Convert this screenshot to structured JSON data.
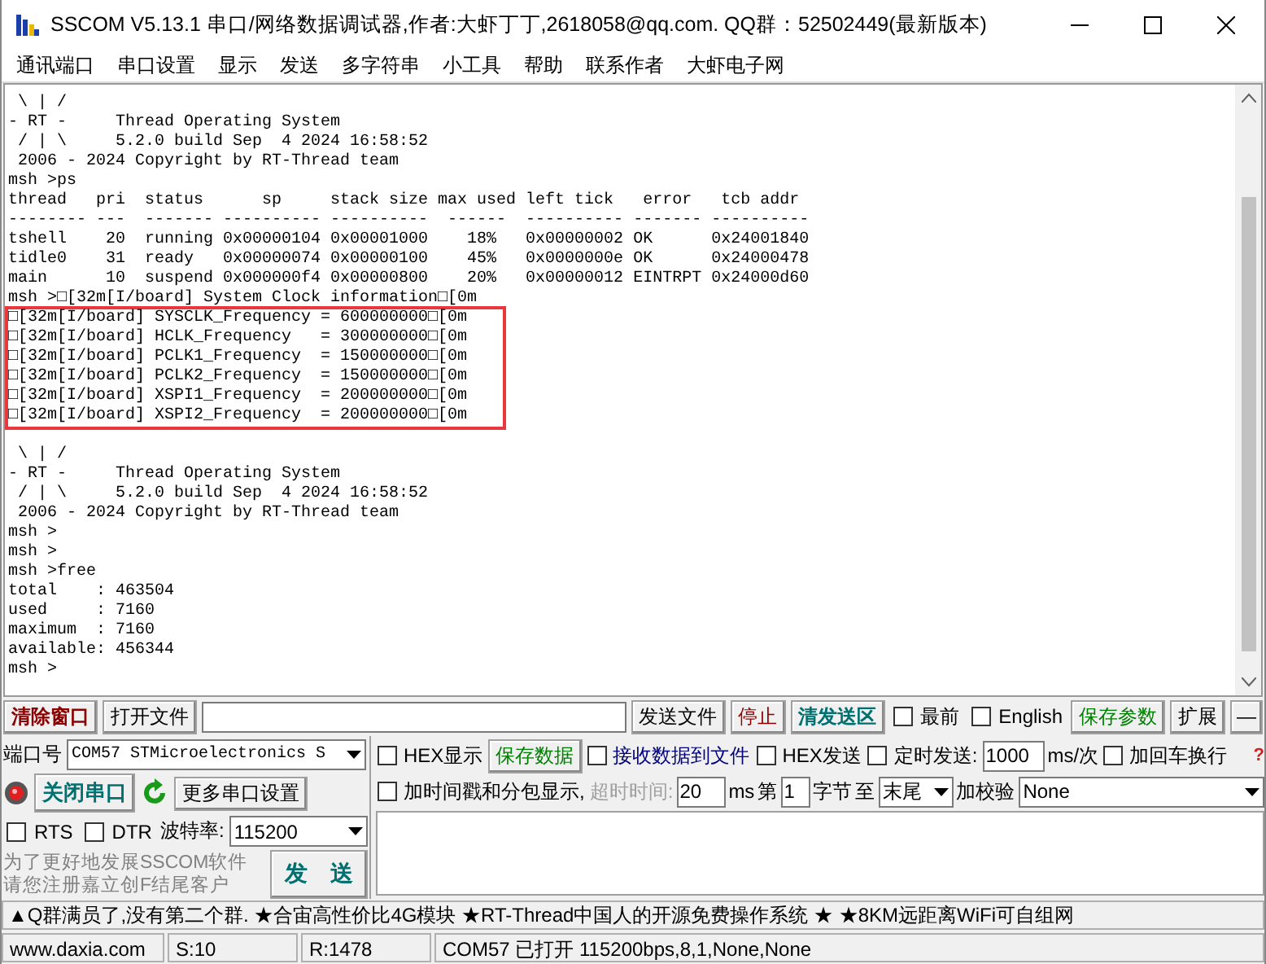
{
  "window": {
    "title": "SSCOM V5.13.1 串口/网络数据调试器,作者:大虾丁丁,2618058@qq.com. QQ群：52502449(最新版本)"
  },
  "menu": [
    "通讯端口",
    "串口设置",
    "显示",
    "发送",
    "多字符串",
    "小工具",
    "帮助",
    "联系作者",
    "大虾电子网"
  ],
  "terminal": {
    "blocks": [
      {
        "kind": "plain",
        "lines": [
          " \\ | /",
          "- RT -     Thread Operating System",
          " / | \\     5.2.0 build Sep  4 2024 16:58:52",
          " 2006 - 2024 Copyright by RT-Thread team",
          "msh >ps",
          "thread   pri  status      sp     stack size max used left tick   error   tcb addr",
          "-------- ---  ------- ---------- ----------  ------  ---------- ------- ----------",
          "tshell    20  running 0x00000104 0x00001000    18%   0x00000002 OK      0x24001840",
          "tidle0    31  ready   0x00000074 0x00000100    45%   0x0000000e OK      0x24000478",
          "main      10  suspend 0x000000f4 0x00000800    20%   0x00000012 EINTRPT 0x24000d60",
          "msh >□[32m[I/board] System Clock information□[0m"
        ]
      },
      {
        "kind": "highlighted",
        "lines": [
          "□[32m[I/board] SYSCLK_Frequency = 600000000□[0m",
          "□[32m[I/board] HCLK_Frequency   = 300000000□[0m",
          "□[32m[I/board] PCLK1_Frequency  = 150000000□[0m",
          "□[32m[I/board] PCLK2_Frequency  = 150000000□[0m",
          "□[32m[I/board] XSPI1_Frequency  = 200000000□[0m",
          "□[32m[I/board] XSPI2_Frequency  = 200000000□[0m"
        ]
      },
      {
        "kind": "plain",
        "lines": [
          " \\ | /",
          "- RT -     Thread Operating System",
          " / | \\     5.2.0 build Sep  4 2024 16:58:52",
          " 2006 - 2024 Copyright by RT-Thread team",
          "msh >",
          "msh >",
          "msh >free",
          "total    : 463504",
          "used     : 7160",
          "maximum  : 7160",
          "available: 456344",
          "msh >"
        ]
      }
    ]
  },
  "toolbar": {
    "clear_window": "清除窗口",
    "open_file": "打开文件",
    "send_file": "发送文件",
    "stop": "停止",
    "clear_send": "清发送区",
    "topmost": {
      "label": "最前",
      "checked": false
    },
    "english": {
      "label": "English",
      "checked": false
    },
    "save_params": "保存参数",
    "expand": "扩展",
    "collapse": "—"
  },
  "port_panel": {
    "port_label": "端口号",
    "port_value": "COM57 STMicroelectronics S",
    "close_port": "关闭串口",
    "more_settings": "更多串口设置",
    "rts": {
      "label": "RTS",
      "checked": false
    },
    "dtr": {
      "label": "DTR",
      "checked": false
    },
    "baud_label": "波特率:",
    "baud_value": "115200",
    "promo": [
      "为了更好地发展SSCOM软件",
      "请您注册嘉立创F结尾客户"
    ],
    "send": "发　送"
  },
  "options": {
    "hex_display": {
      "label": "HEX显示",
      "checked": false
    },
    "save_data": "保存数据",
    "receive_to_file": {
      "label": "接收数据到文件",
      "checked": false
    },
    "hex_send": {
      "label": "HEX发送",
      "checked": false
    },
    "timed_send": {
      "label": "定时发送:",
      "checked": false
    },
    "interval": "1000",
    "interval_unit": "ms/次",
    "append_crlf": {
      "label": "加回车换行",
      "checked": false
    },
    "help": "?",
    "timestamp": {
      "label": "加时间戳和分包显示,",
      "checked": false
    },
    "timeout_label": "超时时间:",
    "timeout_disabled": true,
    "timeout": "20",
    "timeout_unit": "ms",
    "byte_from_label": "第",
    "byte_from": "1",
    "byte_unit": "字节",
    "to_label": "至",
    "byte_to": "末尾",
    "checksum_label": "加校验",
    "checksum": "None"
  },
  "ticker": "▲Q群满员了,没有第二个群. ★合宙高性价比4G模块 ★RT-Thread中国人的开源免费操作系统 ★ ★8KM远距离WiFi可自组网",
  "status_bar": [
    "www.daxia.com",
    "S:10",
    "R:1478",
    "COM57 已打开  115200bps,8,1,None,None"
  ]
}
